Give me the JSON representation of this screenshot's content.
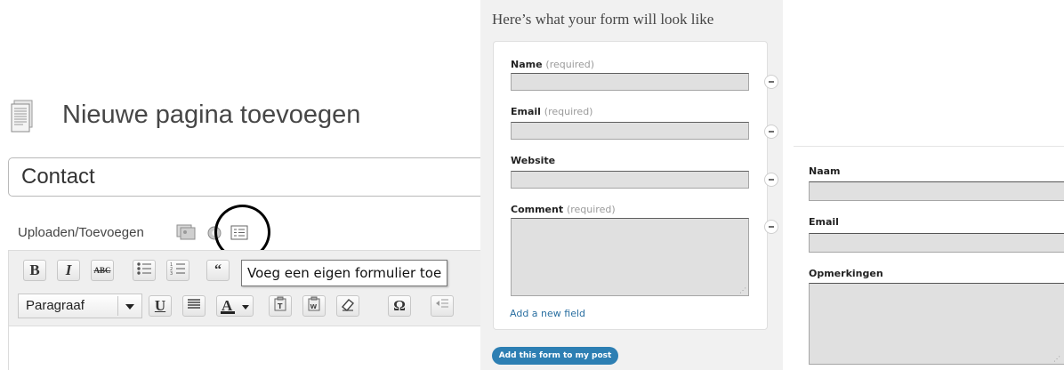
{
  "editor": {
    "page_title": "Nieuwe pagina toevoegen",
    "title_value": "Contact",
    "upload_label": "Uploaden/Toevoegen",
    "format_select_value": "Paragraaf",
    "tooltip": "Voeg een eigen formulier toe",
    "toolbar_row1_icons": [
      "bold-icon",
      "italic-icon",
      "strikethrough-icon",
      "bullet-list-icon",
      "numbered-list-icon",
      "blockquote-icon"
    ],
    "toolbar_row2_icons": [
      "underline-icon",
      "justify-icon",
      "text-color-icon",
      "paste-text-icon",
      "paste-word-icon",
      "eraser-icon",
      "omega-icon",
      "outdent-icon"
    ]
  },
  "preview": {
    "heading": "Here’s what your form will look like",
    "fields": [
      {
        "label": "Name",
        "required": "(required)"
      },
      {
        "label": "Email",
        "required": "(required)"
      },
      {
        "label": "Website",
        "required": ""
      },
      {
        "label": "Comment",
        "required": "(required)"
      }
    ],
    "add_field_link": "Add a new field",
    "add_form_button": "Add this form to my post"
  },
  "rendered_form": {
    "fields": [
      "Naam",
      "Email",
      "Opmerkingen"
    ]
  }
}
